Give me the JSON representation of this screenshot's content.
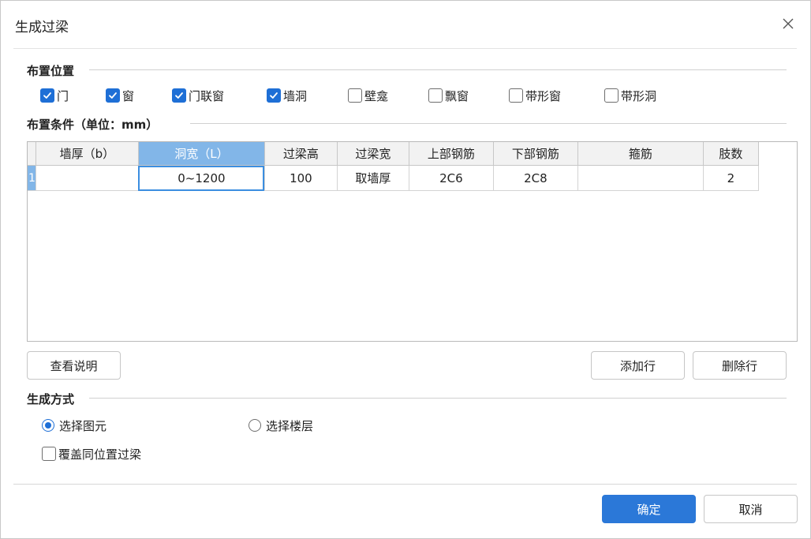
{
  "dialog": {
    "title": "生成过梁",
    "close_icon": "close-icon"
  },
  "placement": {
    "section_label": "布置位置",
    "options": [
      {
        "label": "门",
        "checked": true
      },
      {
        "label": "窗",
        "checked": true
      },
      {
        "label": "门联窗",
        "checked": true
      },
      {
        "label": "墙洞",
        "checked": true
      },
      {
        "label": "壁龛",
        "checked": false
      },
      {
        "label": "飘窗",
        "checked": false
      },
      {
        "label": "带形窗",
        "checked": false
      },
      {
        "label": "带形洞",
        "checked": false
      }
    ]
  },
  "conditions": {
    "section_label": "布置条件（单位：mm）",
    "columns": [
      "墙厚（b）",
      "洞宽（L）",
      "过梁高",
      "过梁宽",
      "上部钢筋",
      "下部钢筋",
      "箍筋",
      "肢数"
    ],
    "active_column": 1,
    "rows": [
      {
        "row_no": "1",
        "cells": [
          "",
          "0~1200",
          "100",
          "取墙厚",
          "2C6",
          "2C8",
          "",
          "2"
        ]
      }
    ],
    "selected_cell": {
      "row": 0,
      "col": 1
    }
  },
  "actions": {
    "view_help": "查看说明",
    "add_row": "添加行",
    "delete_row": "删除行"
  },
  "generate": {
    "section_label": "生成方式",
    "radio_select_element": "选择图元",
    "radio_select_floor": "选择楼层",
    "selected": "select_element",
    "overwrite_label": "覆盖同位置过梁",
    "overwrite_checked": false
  },
  "footer": {
    "ok": "确定",
    "cancel": "取消"
  },
  "colors": {
    "accent": "#1e6fd6",
    "header_active": "#82b6e8",
    "primary_button": "#2b78d8"
  }
}
